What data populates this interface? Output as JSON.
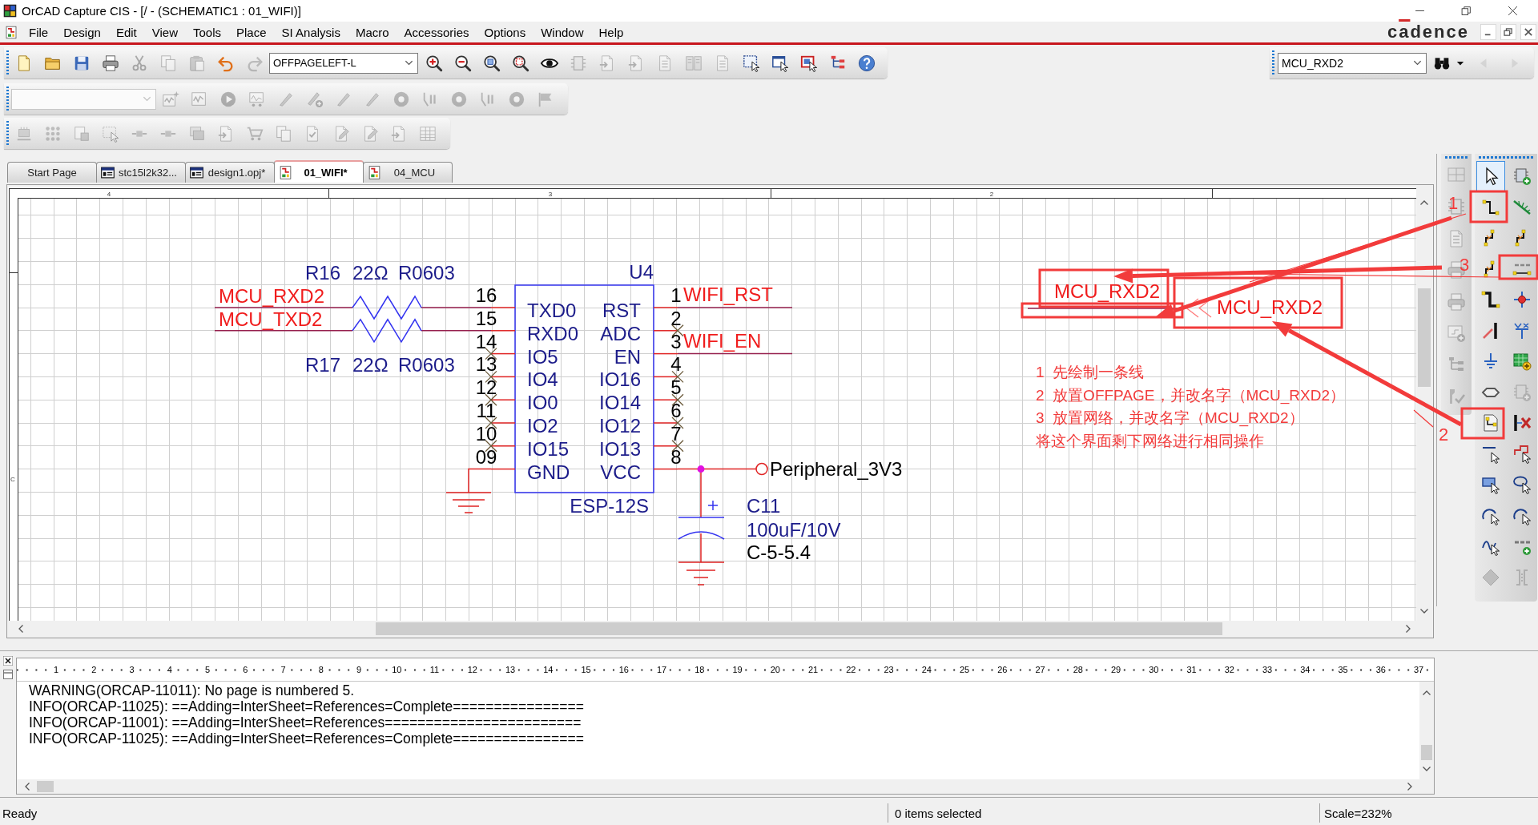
{
  "window": {
    "title": "OrCAD Capture CIS - [/ - (SCHEMATIC1 : 01_WIFI)]"
  },
  "menu": [
    "File",
    "Design",
    "Edit",
    "View",
    "Tools",
    "Place",
    "SI Analysis",
    "Macro",
    "Accessories",
    "Options",
    "Window",
    "Help"
  ],
  "logo": "cadence",
  "main_toolbar": {
    "tools_before": [
      {
        "disabled": false
      },
      {
        "disabled": false
      },
      {
        "disabled": false
      },
      {
        "disabled": false
      },
      {
        "disabled": true
      },
      {
        "disabled": true
      },
      {
        "disabled": true
      },
      {
        "disabled": false
      },
      {
        "disabled": true
      }
    ],
    "symbol": "OFFPAGELEFT-L",
    "tools_after": [
      {
        "disabled": false
      },
      {
        "disabled": false
      },
      {
        "disabled": false
      },
      {
        "disabled": false
      },
      {
        "disabled": false
      },
      {
        "disabled": true
      },
      {
        "disabled": true
      },
      {
        "disabled": true
      },
      {
        "disabled": true
      },
      {
        "disabled": true
      },
      {
        "disabled": true
      },
      {
        "disabled": false
      },
      {
        "disabled": false
      },
      {
        "disabled": false
      },
      {
        "disabled": false
      },
      {
        "disabled": false
      }
    ]
  },
  "sim_toolbar": {
    "combo": {
      "disabled": true
    },
    "tools": [
      {
        "disabled": true
      },
      {
        "disabled": true
      },
      {
        "disabled": true
      },
      {
        "disabled": true
      },
      {
        "disabled": true
      },
      {
        "disabled": true
      },
      {
        "disabled": true
      },
      {
        "disabled": true
      },
      {
        "disabled": true
      },
      {
        "disabled": true
      },
      {
        "disabled": true
      },
      {
        "disabled": true
      },
      {
        "disabled": true
      },
      {
        "disabled": true
      }
    ]
  },
  "edit_toolbar": {
    "tools": [
      {
        "disabled": true
      },
      {
        "disabled": true
      },
      {
        "disabled": true
      },
      {
        "disabled": true
      },
      {
        "disabled": true
      },
      {
        "disabled": true
      },
      {
        "disabled": true
      },
      {
        "disabled": true
      },
      {
        "disabled": true
      },
      {
        "disabled": true
      },
      {
        "disabled": true
      },
      {
        "disabled": true
      },
      {
        "disabled": true
      },
      {
        "disabled": true
      },
      {
        "disabled": true
      }
    ]
  },
  "find_toolbar": {
    "value": "MCU_RXD2",
    "tools": [
      {
        "disabled": false
      },
      {
        "disabled": false
      },
      {
        "disabled": true
      },
      {
        "disabled": true
      }
    ]
  },
  "tabs": [
    {
      "label": "Start Page",
      "kind": "start",
      "selected": false
    },
    {
      "label": "stc15l2k32...",
      "kind": "project",
      "selected": false
    },
    {
      "label": "design1.opj*",
      "kind": "project",
      "selected": false
    },
    {
      "label": "01_WIFI*",
      "kind": "schematic",
      "selected": true
    },
    {
      "label": "04_MCU",
      "kind": "schematic",
      "selected": false
    }
  ],
  "schematic": {
    "zones": [
      "4",
      "3",
      "2"
    ],
    "side_zones": [
      "C"
    ],
    "resistors": [
      {
        "ref": "R16",
        "value": "22Ω",
        "footprint": "R0603",
        "net": "MCU_RXD2"
      },
      {
        "ref": "R17",
        "value": "22Ω",
        "footprint": "R0603",
        "net": "MCU_TXD2"
      }
    ],
    "chip": {
      "ref": "U4",
      "part": "ESP-12S",
      "left_pins": [
        {
          "number": "16",
          "name": "TXD0",
          "no_connect": false
        },
        {
          "number": "15",
          "name": "RXD0",
          "no_connect": false
        },
        {
          "number": "14",
          "name": "IO5",
          "no_connect": true
        },
        {
          "number": "13",
          "name": "IO4",
          "no_connect": true
        },
        {
          "number": "12",
          "name": "IO0",
          "no_connect": true
        },
        {
          "number": "11",
          "name": "IO2",
          "no_connect": true
        },
        {
          "number": "10",
          "name": "IO15",
          "no_connect": true
        },
        {
          "number": "09",
          "name": "GND",
          "no_connect": false
        }
      ],
      "right_pins": [
        {
          "number": "1",
          "name": "RST",
          "no_connect": false,
          "net": "WIFI_RST"
        },
        {
          "number": "2",
          "name": "ADC",
          "no_connect": true
        },
        {
          "number": "3",
          "name": "EN",
          "no_connect": false,
          "net": "WIFI_EN"
        },
        {
          "number": "4",
          "name": "IO16",
          "no_connect": true
        },
        {
          "number": "5",
          "name": "IO14",
          "no_connect": true
        },
        {
          "number": "6",
          "name": "IO12",
          "no_connect": true
        },
        {
          "number": "7",
          "name": "IO13",
          "no_connect": true
        },
        {
          "number": "8",
          "name": "VCC",
          "no_connect": false
        }
      ]
    },
    "power_port": "Peripheral_3V3",
    "capacitor": {
      "ref": "C11",
      "value": "100uF/10V",
      "footprint": "C-5-5.4"
    },
    "demo": {
      "net_alias": "MCU_RXD2",
      "offpage": "MCU_RXD2"
    },
    "notes": [
      "1  先绘制一条线",
      "2  放置OFFPAGE，并改名字（MCU_RXD2）",
      "3  放置网络，并改名字（MCU_RXD2）",
      "将这个界面剩下网络进行相同操作"
    ]
  },
  "callouts": [
    "1",
    "3",
    "2"
  ],
  "palette": {
    "side_tools": [
      {
        "disabled": true
      },
      {
        "disabled": true
      },
      {
        "disabled": true
      },
      {
        "disabled": true
      },
      {
        "disabled": true
      },
      {
        "disabled": true
      },
      {
        "disabled": true
      },
      {
        "disabled": true
      }
    ],
    "tools": [
      {
        "selected": true,
        "disabled": false
      },
      {
        "selected": false,
        "disabled": false
      },
      {
        "selected": false,
        "disabled": false
      },
      {
        "selected": false,
        "disabled": false
      },
      {
        "selected": false,
        "disabled": false
      },
      {
        "selected": false,
        "disabled": false
      },
      {
        "selected": false,
        "disabled": false
      },
      {
        "selected": false,
        "disabled": false
      },
      {
        "selected": false,
        "disabled": false
      },
      {
        "selected": false,
        "disabled": false
      },
      {
        "selected": false,
        "disabled": false
      },
      {
        "selected": false,
        "disabled": false
      },
      {
        "selected": false,
        "disabled": false
      },
      {
        "selected": false,
        "disabled": false
      },
      {
        "selected": false,
        "disabled": false
      },
      {
        "selected": false,
        "disabled": true
      },
      {
        "selected": false,
        "disabled": false
      },
      {
        "selected": false,
        "disabled": false
      },
      {
        "selected": false,
        "disabled": false
      },
      {
        "selected": false,
        "disabled": false
      },
      {
        "selected": false,
        "disabled": false
      },
      {
        "selected": false,
        "disabled": false
      },
      {
        "selected": false,
        "disabled": false
      },
      {
        "selected": false,
        "disabled": false
      },
      {
        "selected": false,
        "disabled": false
      },
      {
        "selected": false,
        "disabled": false
      },
      {
        "selected": false,
        "disabled": true
      },
      {
        "selected": false,
        "disabled": true
      }
    ]
  },
  "session_log": {
    "ruler": [
      "1",
      "2",
      "3",
      "4",
      "5",
      "6",
      "7",
      "8",
      "9",
      "10",
      "11",
      "12",
      "13",
      "14",
      "15",
      "16",
      "17",
      "18",
      "19",
      "20",
      "21",
      "22",
      "23",
      "24",
      "25",
      "26",
      "27",
      "28",
      "29",
      "30",
      "31",
      "32",
      "33",
      "34",
      "35",
      "36",
      "37"
    ],
    "lines": [
      "WARNING(ORCAP-11011): No page is numbered 5.",
      "INFO(ORCAP-11025): ==Adding=InterSheet=References=Complete================",
      "INFO(ORCAP-11001): ==Adding=InterSheet=References========================",
      "INFO(ORCAP-11025): ==Adding=InterSheet=References=Complete================"
    ]
  },
  "status_bar": {
    "message": "Ready",
    "selection": "0 items selected",
    "scale": "Scale=232%"
  }
}
